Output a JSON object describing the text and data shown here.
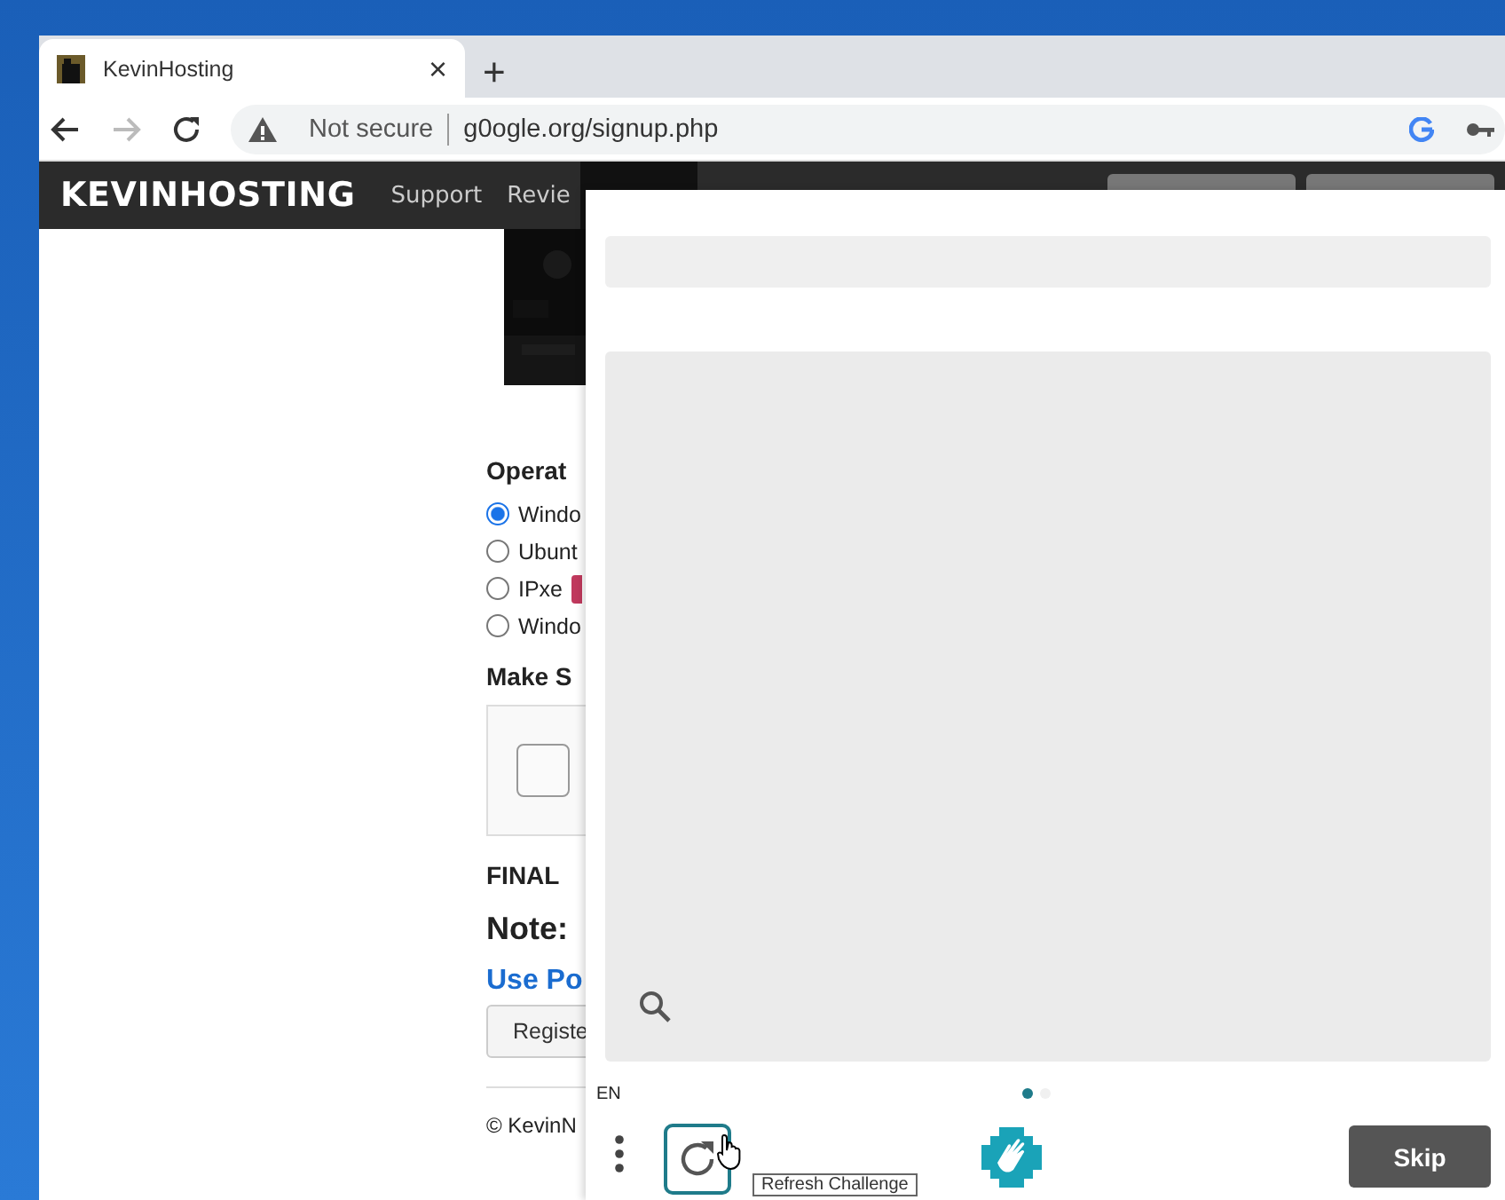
{
  "browser": {
    "tab_title": "KevinHosting",
    "tab_close": "×",
    "new_tab": "+",
    "security": "Not secure",
    "url": "g0ogle.org/signup.php"
  },
  "navbar": {
    "brand": "KEVINHOSTING",
    "links": [
      {
        "label": "Support"
      },
      {
        "label": "Revie"
      }
    ]
  },
  "form": {
    "section_title": "Operat",
    "os_options": [
      {
        "label": "Windo",
        "selected": true,
        "badge": false
      },
      {
        "label": "Ubunt",
        "selected": false,
        "badge": false
      },
      {
        "label": "IPxe",
        "selected": false,
        "badge": true
      },
      {
        "label": "Windo",
        "selected": false,
        "badge": false
      }
    ],
    "captcha_title": "Make S",
    "captcha_checked": false,
    "final": "FINAL",
    "note": "Note:",
    "link": "Use Po",
    "register": "Registe",
    "footer": "© KevinN"
  },
  "challenge": {
    "language": "EN",
    "pages": [
      {
        "selected": true
      },
      {
        "selected": false
      }
    ],
    "refresh_tooltip": "Refresh Challenge",
    "skip": "Skip"
  }
}
